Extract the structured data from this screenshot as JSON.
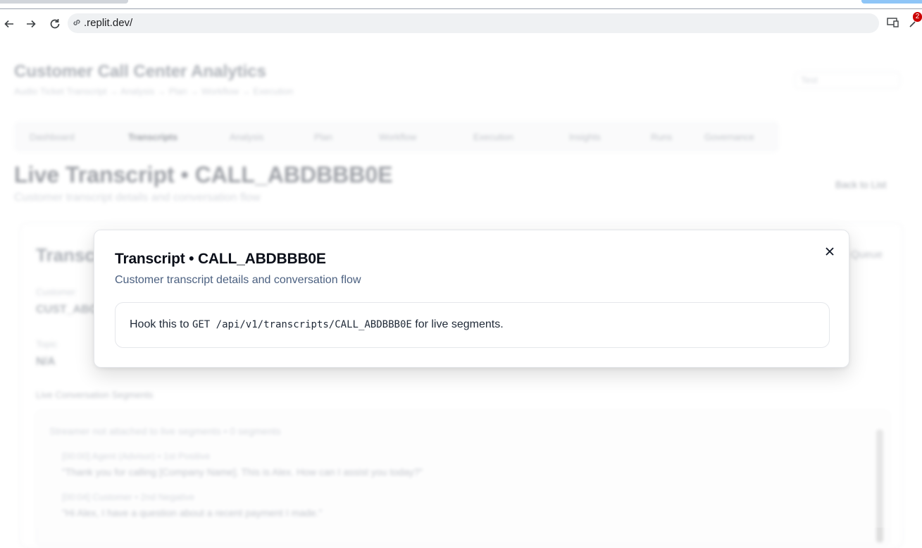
{
  "browser": {
    "url": ".replit.dev/",
    "extension_badge": "2"
  },
  "background": {
    "app_title": "Customer Call Center Analytics",
    "breadcrumb": "Audio Ticket Transcript → Analysis → Plan → Workflow → Execution",
    "select_value": "Test",
    "tabs": [
      "Dashboard",
      "Transcripts",
      "Analysis",
      "Plan",
      "Workflow",
      "Execution",
      "Insights",
      "Runs",
      "Governance"
    ],
    "page_title": "Live Transcript • CALL_ABDBBB0E",
    "page_subtitle": "Customer transcript details and conversation flow",
    "back_label": "Back to List",
    "card_title": "Transcript",
    "card_right": "Mock Queue",
    "customer_label": "Customer",
    "customer_value": "CUST_ABCD",
    "topic_label": "Topic",
    "topic_value": "N/A",
    "segments_label": "Live Conversation Segments",
    "segments_header": "Streamer not attached to live segments • 0 segments",
    "segments": [
      {
        "meta": "[00:00] Agent (Advisor) • 1st Positive",
        "text": "\"Thank you for calling [Company Name]. This is Alex. How can I assist you today?\""
      },
      {
        "meta": "[00:04] Customer • 2nd Negative",
        "text": "\"Hi Alex, I have a question about a recent payment I made.\""
      }
    ]
  },
  "dialog": {
    "title": "Transcript • CALL_ABDBBB0E",
    "subtitle": "Customer transcript details and conversation flow",
    "hint_prefix": "Hook this to ",
    "hint_code": "GET /api/v1/transcripts/CALL_ABDBBB0E",
    "hint_suffix": " for live segments."
  },
  "icons": {
    "back": "arrow-left-icon",
    "forward": "arrow-right-icon",
    "reload": "reload-icon",
    "link": "link-icon",
    "close": "close-icon"
  }
}
